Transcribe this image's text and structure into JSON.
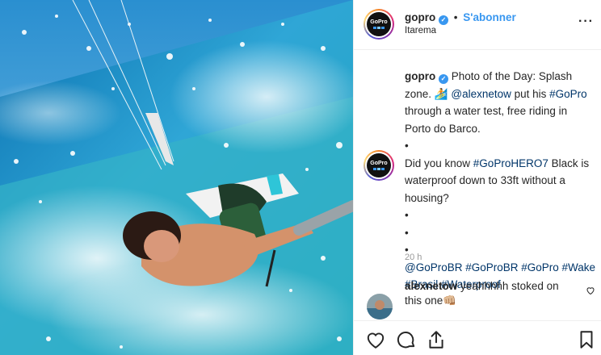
{
  "post": {
    "image_alt": "Kitesurfer splashing through a wave, photo taken from a pole camera",
    "author": {
      "username": "gopro",
      "verified_icon": "verified-badge-icon",
      "follow_label": "S'abonner",
      "separator": "•",
      "location": "Itarema",
      "avatar_text": "GoPro"
    },
    "more_icon": "ellipsis-icon",
    "caption": {
      "username": "gopro",
      "lines": [
        "Photo of the Day: Splash",
        "zone. 🏄 @alexnetow put his #GoPro",
        "through a water test, free riding in",
        "Porto do Barco.",
        "•",
        "Did you know #GoProHERO7 Black is",
        "waterproof down to 33ft without a",
        "housing?",
        "•",
        "•",
        "•",
        "@GoProBR #GoProBR #GoPro #Wake",
        "#Brasil #Waterproof"
      ],
      "time": "20 h"
    },
    "comment": {
      "username": "alexnetow",
      "text": "yeahhhhh stoked on this one👊🏼"
    },
    "actions": {
      "like_icon": "heart-icon",
      "comment_icon": "speech-bubble-icon",
      "share_icon": "share-icon",
      "save_icon": "bookmark-icon"
    },
    "colors": {
      "link": "#003569",
      "accent": "#3897f0",
      "muted": "#999999"
    }
  }
}
